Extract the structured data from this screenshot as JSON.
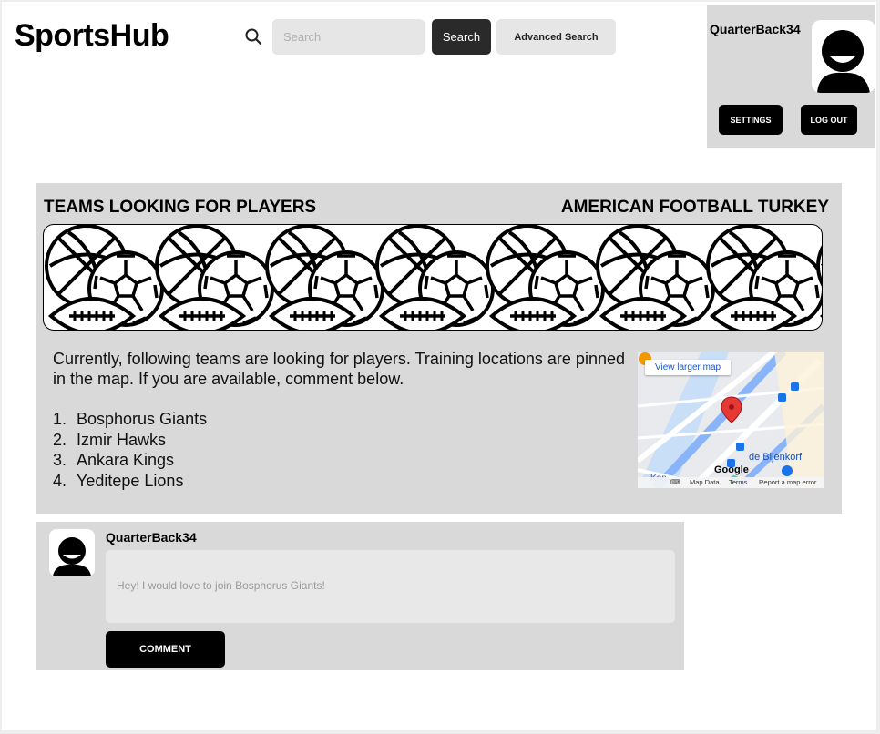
{
  "header": {
    "logo": "SportsHub",
    "search_placeholder": "Search",
    "search_button": "Search",
    "advanced_search_button": "Advanced Search"
  },
  "user_panel": {
    "username": "QuarterBack34",
    "settings_button": "SETTINGS",
    "logout_button": "LOG OUT"
  },
  "post": {
    "title": "TEAMS LOOKING FOR PLAYERS",
    "category": "AMERICAN FOOTBALL TURKEY",
    "description": "Currently, following teams are looking for players. Training locations are pinned in the map. If you are available, comment below.",
    "teams": [
      {
        "number": "1.",
        "name": "Bosphorus Giants"
      },
      {
        "number": "2.",
        "name": "Izmir Hawks"
      },
      {
        "number": "3.",
        "name": "Ankara Kings"
      },
      {
        "number": "4.",
        "name": "Yeditepe Lions"
      }
    ],
    "banner_icon": "sports-balls-icon"
  },
  "map": {
    "view_larger": "View larger map",
    "store_label": "de Bijenkorf",
    "google_label": "Google",
    "partial_label": "Kon",
    "map_data": "Map Data",
    "terms": "Terms",
    "report": "Report a map error",
    "pin_color": "#e53935"
  },
  "comment": {
    "username": "QuarterBack34",
    "text": "Hey! I would love to join Bosphorus Giants!",
    "button": "COMMENT"
  },
  "colors": {
    "panel": "#d9d9d9",
    "dark_button": "#2a2a2a",
    "black_button": "#000000"
  }
}
